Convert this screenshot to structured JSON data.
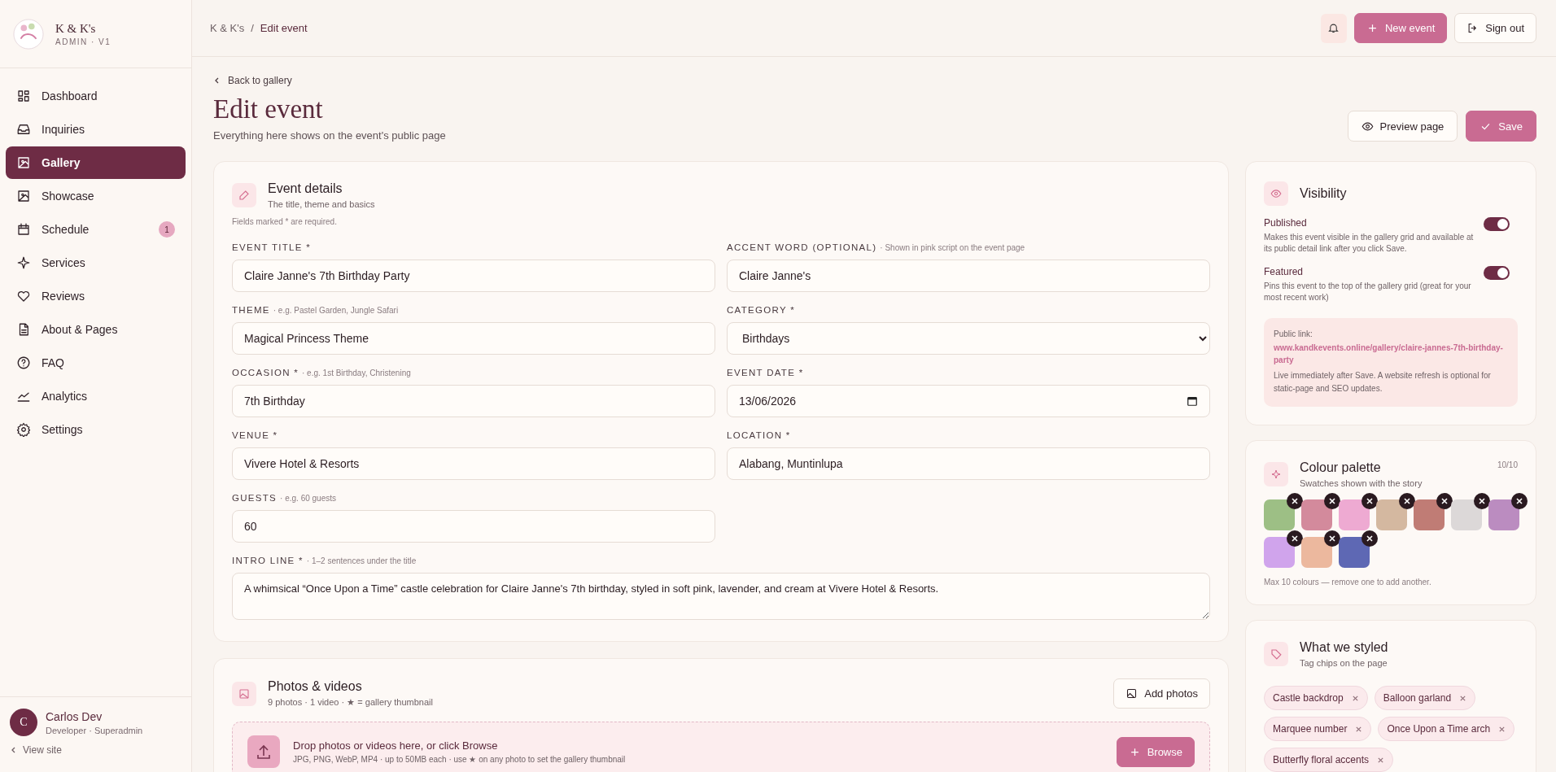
{
  "brand": {
    "name": "K & K's",
    "subtitle": "ADMIN · V1"
  },
  "sidebar": {
    "items": [
      {
        "label": "Dashboard",
        "selected": false
      },
      {
        "label": "Inquiries",
        "selected": false
      },
      {
        "label": "Gallery",
        "selected": true
      },
      {
        "label": "Showcase",
        "selected": false
      },
      {
        "label": "Schedule",
        "selected": false,
        "badge": "1"
      },
      {
        "label": "Services",
        "selected": false
      },
      {
        "label": "Reviews",
        "selected": false
      },
      {
        "label": "About & Pages",
        "selected": false
      },
      {
        "label": "FAQ",
        "selected": false
      },
      {
        "label": "Analytics",
        "selected": false
      },
      {
        "label": "Settings",
        "selected": false
      }
    ],
    "user": {
      "initial": "C",
      "name": "Carlos Dev",
      "role": "Developer · Superadmin"
    },
    "view_site": "View site"
  },
  "breadcrumb": {
    "parent": "K & K's",
    "separator": "/",
    "current": "Edit event"
  },
  "topbar": {
    "new_event": "New event",
    "sign_out": "Sign out"
  },
  "header": {
    "back": "Back to gallery",
    "title": "Edit event",
    "subtitle": "Everything here shows on the event's public page",
    "preview": "Preview page",
    "save": "Save"
  },
  "details": {
    "title": "Event details",
    "subtitle": "The title, theme and basics",
    "note": "Fields marked * are required.",
    "fields": [
      {
        "kind": "text",
        "label": "EVENT TITLE *",
        "value": "Claire Janne's 7th Birthday Party"
      },
      {
        "kind": "text",
        "label": "ACCENT WORD (OPTIONAL)",
        "hint": "· Shown in pink script on the event page",
        "value": "Claire Janne's"
      },
      {
        "kind": "text",
        "label": "THEME",
        "hint": "· e.g. Pastel Garden, Jungle Safari",
        "value": "Magical Princess Theme"
      },
      {
        "kind": "select",
        "label": "CATEGORY *",
        "value": "Birthdays"
      },
      {
        "kind": "text",
        "label": "OCCASION *",
        "hint": "· e.g. 1st Birthday, Christening",
        "value": "7th Birthday"
      },
      {
        "kind": "date",
        "label": "EVENT DATE *",
        "value": "13/06/2026"
      },
      {
        "kind": "text",
        "label": "VENUE *",
        "value": "Vivere Hotel & Resorts"
      },
      {
        "kind": "text",
        "label": "LOCATION *",
        "value": "Alabang, Muntinlupa"
      },
      {
        "kind": "text",
        "label": "GUESTS",
        "hint": "· e.g. 60 guests",
        "value": "60"
      },
      {
        "kind": "textarea",
        "label": "INTRO LINE *",
        "hint": "· 1–2 sentences under the title",
        "value": "A whimsical “Once Upon a Time” castle celebration for Claire Janne's 7th birthday, styled in soft pink, lavender, and cream at Vivere Hotel & Resorts."
      }
    ]
  },
  "photos": {
    "title": "Photos & videos",
    "subtitle": "9 photos · 1 video · ★ = gallery thumbnail",
    "add": "Add photos",
    "drop_title": "Drop photos or videos here, or click Browse",
    "drop_sub": "JPG, PNG, WebP, MP4 · up to 50MB each · use ★ on any photo to set the gallery thumbnail",
    "browse": "Browse"
  },
  "visibility": {
    "title": "Visibility",
    "toggles": [
      {
        "label": "Published",
        "description": "Makes this event visible in the gallery grid and available at its public detail link after you click Save.",
        "on": true
      },
      {
        "label": "Featured",
        "description": "Pins this event to the top of the gallery grid (great for your most recent work)",
        "on": true
      }
    ],
    "link_label": "Public link:",
    "link": "www.kandkevents.online/gallery/claire-jannes-7th-birthday-party",
    "link_note": "Live immediately after Save. A website refresh is optional for static-page and SEO updates."
  },
  "palette": {
    "title": "Colour palette",
    "subtitle": "Swatches shown with the story",
    "count": "10/10",
    "swatches": [
      {
        "color": "#9dbf85"
      },
      {
        "color": "#d38a9c"
      },
      {
        "color": "#eeaad2"
      },
      {
        "color": "#d4b8a0"
      },
      {
        "color": "#c07c75"
      },
      {
        "color": "#dcd8d8"
      },
      {
        "color": "#bb8cc0"
      },
      {
        "color": "#d0a4ec"
      },
      {
        "color": "#ecb89e"
      },
      {
        "color": "#5e68b4"
      }
    ],
    "note": "Max 10 colours — remove one to add another."
  },
  "styled": {
    "title": "What we styled",
    "subtitle": "Tag chips on the page",
    "tags": [
      "Castle backdrop",
      "Balloon garland",
      "Marquee number",
      "Once Upon a Time arch",
      "Butterfly floral accents"
    ]
  }
}
